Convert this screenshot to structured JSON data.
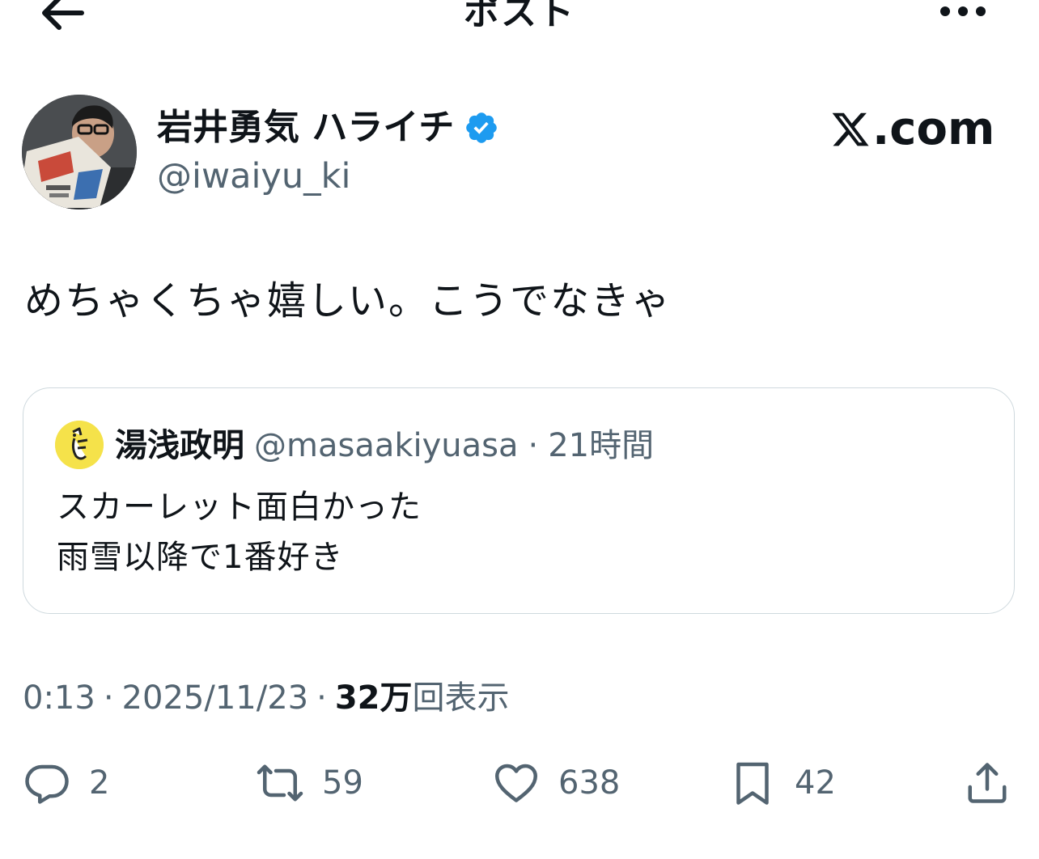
{
  "header": {
    "title": "ポスト",
    "back_icon": "arrow-left-icon",
    "more_icon": "more-horizontal-icon"
  },
  "author": {
    "name": "岩井勇気 ハライチ",
    "handle": "@iwaiyu_ki",
    "verified": true,
    "verified_color": "#1d9bf0"
  },
  "brand": {
    "suffix": ".com",
    "logo_icon": "x-logo-icon"
  },
  "post": {
    "text": "めちゃくちゃ嬉しい。こうでなきゃ"
  },
  "quote": {
    "name": "湯浅政明",
    "handle": "@masaakiyuasa",
    "separator": "·",
    "time": "21時間",
    "lines": [
      "スカーレット面白かった",
      "雨雪以降で1番好き"
    ],
    "avatar_color": "#f5e24a"
  },
  "meta": {
    "time": "0:13",
    "separator": "·",
    "date": "2025/11/23",
    "views_number": "32万",
    "views_label": "回表示"
  },
  "actions": {
    "replies": "2",
    "reposts": "59",
    "likes": "638",
    "bookmarks": "42"
  },
  "colors": {
    "text": "#0f1419",
    "secondary": "#536471",
    "border": "#cfd9de"
  }
}
